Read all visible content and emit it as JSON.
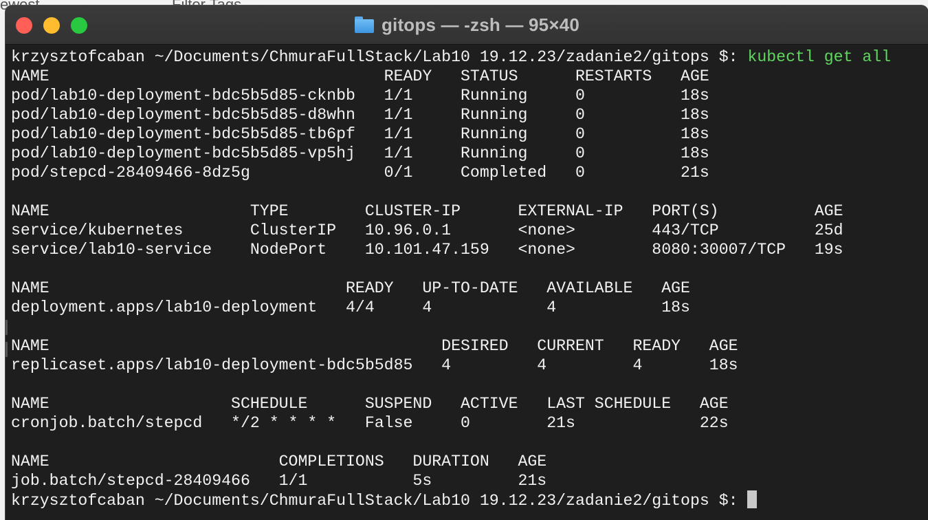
{
  "background": {
    "app_fragments": [
      "ewest",
      "Filter Tags"
    ]
  },
  "window": {
    "title": "gitops — -zsh — 95×40",
    "icon": "folder-icon",
    "colors": {
      "close": "#ff5f57",
      "minimize": "#febc2e",
      "maximize": "#28c840",
      "background": "#1e1e1e",
      "foreground": "#f2f2f2",
      "command": "#5fd75f"
    }
  },
  "terminal": {
    "prompt": "krzysztofcaban ~/Documents/ChmuraFullStack/Lab10 19.12.23/zadanie2/gitops $: ",
    "command": "kubectl get all",
    "output_lines": [
      "NAME                                   READY   STATUS      RESTARTS   AGE",
      "pod/lab10-deployment-bdc5b5d85-cknbb   1/1     Running     0          18s",
      "pod/lab10-deployment-bdc5b5d85-d8whn   1/1     Running     0          18s",
      "pod/lab10-deployment-bdc5b5d85-tb6pf   1/1     Running     0          18s",
      "pod/lab10-deployment-bdc5b5d85-vp5hj   1/1     Running     0          18s",
      "pod/stepcd-28409466-8dz5g              0/1     Completed   0          21s",
      "",
      "NAME                     TYPE        CLUSTER-IP      EXTERNAL-IP   PORT(S)          AGE",
      "service/kubernetes       ClusterIP   10.96.0.1       <none>        443/TCP          25d",
      "service/lab10-service    NodePort    10.101.47.159   <none>        8080:30007/TCP   19s",
      "",
      "NAME                               READY   UP-TO-DATE   AVAILABLE   AGE",
      "deployment.apps/lab10-deployment   4/4     4            4           18s",
      "",
      "NAME                                         DESIRED   CURRENT   READY   AGE",
      "replicaset.apps/lab10-deployment-bdc5b5d85   4         4         4       18s",
      "",
      "NAME                   SCHEDULE      SUSPEND   ACTIVE   LAST SCHEDULE   AGE",
      "cronjob.batch/stepcd   */2 * * * *   False     0        21s             22s",
      "",
      "NAME                        COMPLETIONS   DURATION   AGE",
      "job.batch/stepcd-28409466   1/1           5s         21s"
    ],
    "final_prompt": "krzysztofcaban ~/Documents/ChmuraFullStack/Lab10 19.12.23/zadanie2/gitops $: "
  }
}
